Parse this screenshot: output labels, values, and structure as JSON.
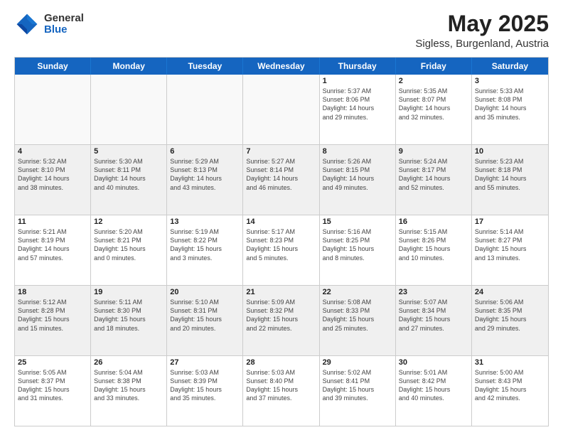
{
  "logo": {
    "general": "General",
    "blue": "Blue"
  },
  "title": "May 2025",
  "location": "Sigless, Burgenland, Austria",
  "days": [
    "Sunday",
    "Monday",
    "Tuesday",
    "Wednesday",
    "Thursday",
    "Friday",
    "Saturday"
  ],
  "rows": [
    [
      {
        "num": "",
        "info": "",
        "empty": true
      },
      {
        "num": "",
        "info": "",
        "empty": true
      },
      {
        "num": "",
        "info": "",
        "empty": true
      },
      {
        "num": "",
        "info": "",
        "empty": true
      },
      {
        "num": "1",
        "info": "Sunrise: 5:37 AM\nSunset: 8:06 PM\nDaylight: 14 hours\nand 29 minutes."
      },
      {
        "num": "2",
        "info": "Sunrise: 5:35 AM\nSunset: 8:07 PM\nDaylight: 14 hours\nand 32 minutes."
      },
      {
        "num": "3",
        "info": "Sunrise: 5:33 AM\nSunset: 8:08 PM\nDaylight: 14 hours\nand 35 minutes."
      }
    ],
    [
      {
        "num": "4",
        "info": "Sunrise: 5:32 AM\nSunset: 8:10 PM\nDaylight: 14 hours\nand 38 minutes."
      },
      {
        "num": "5",
        "info": "Sunrise: 5:30 AM\nSunset: 8:11 PM\nDaylight: 14 hours\nand 40 minutes."
      },
      {
        "num": "6",
        "info": "Sunrise: 5:29 AM\nSunset: 8:13 PM\nDaylight: 14 hours\nand 43 minutes."
      },
      {
        "num": "7",
        "info": "Sunrise: 5:27 AM\nSunset: 8:14 PM\nDaylight: 14 hours\nand 46 minutes."
      },
      {
        "num": "8",
        "info": "Sunrise: 5:26 AM\nSunset: 8:15 PM\nDaylight: 14 hours\nand 49 minutes."
      },
      {
        "num": "9",
        "info": "Sunrise: 5:24 AM\nSunset: 8:17 PM\nDaylight: 14 hours\nand 52 minutes."
      },
      {
        "num": "10",
        "info": "Sunrise: 5:23 AM\nSunset: 8:18 PM\nDaylight: 14 hours\nand 55 minutes."
      }
    ],
    [
      {
        "num": "11",
        "info": "Sunrise: 5:21 AM\nSunset: 8:19 PM\nDaylight: 14 hours\nand 57 minutes."
      },
      {
        "num": "12",
        "info": "Sunrise: 5:20 AM\nSunset: 8:21 PM\nDaylight: 15 hours\nand 0 minutes."
      },
      {
        "num": "13",
        "info": "Sunrise: 5:19 AM\nSunset: 8:22 PM\nDaylight: 15 hours\nand 3 minutes."
      },
      {
        "num": "14",
        "info": "Sunrise: 5:17 AM\nSunset: 8:23 PM\nDaylight: 15 hours\nand 5 minutes."
      },
      {
        "num": "15",
        "info": "Sunrise: 5:16 AM\nSunset: 8:25 PM\nDaylight: 15 hours\nand 8 minutes."
      },
      {
        "num": "16",
        "info": "Sunrise: 5:15 AM\nSunset: 8:26 PM\nDaylight: 15 hours\nand 10 minutes."
      },
      {
        "num": "17",
        "info": "Sunrise: 5:14 AM\nSunset: 8:27 PM\nDaylight: 15 hours\nand 13 minutes."
      }
    ],
    [
      {
        "num": "18",
        "info": "Sunrise: 5:12 AM\nSunset: 8:28 PM\nDaylight: 15 hours\nand 15 minutes."
      },
      {
        "num": "19",
        "info": "Sunrise: 5:11 AM\nSunset: 8:30 PM\nDaylight: 15 hours\nand 18 minutes."
      },
      {
        "num": "20",
        "info": "Sunrise: 5:10 AM\nSunset: 8:31 PM\nDaylight: 15 hours\nand 20 minutes."
      },
      {
        "num": "21",
        "info": "Sunrise: 5:09 AM\nSunset: 8:32 PM\nDaylight: 15 hours\nand 22 minutes."
      },
      {
        "num": "22",
        "info": "Sunrise: 5:08 AM\nSunset: 8:33 PM\nDaylight: 15 hours\nand 25 minutes."
      },
      {
        "num": "23",
        "info": "Sunrise: 5:07 AM\nSunset: 8:34 PM\nDaylight: 15 hours\nand 27 minutes."
      },
      {
        "num": "24",
        "info": "Sunrise: 5:06 AM\nSunset: 8:35 PM\nDaylight: 15 hours\nand 29 minutes."
      }
    ],
    [
      {
        "num": "25",
        "info": "Sunrise: 5:05 AM\nSunset: 8:37 PM\nDaylight: 15 hours\nand 31 minutes."
      },
      {
        "num": "26",
        "info": "Sunrise: 5:04 AM\nSunset: 8:38 PM\nDaylight: 15 hours\nand 33 minutes."
      },
      {
        "num": "27",
        "info": "Sunrise: 5:03 AM\nSunset: 8:39 PM\nDaylight: 15 hours\nand 35 minutes."
      },
      {
        "num": "28",
        "info": "Sunrise: 5:03 AM\nSunset: 8:40 PM\nDaylight: 15 hours\nand 37 minutes."
      },
      {
        "num": "29",
        "info": "Sunrise: 5:02 AM\nSunset: 8:41 PM\nDaylight: 15 hours\nand 39 minutes."
      },
      {
        "num": "30",
        "info": "Sunrise: 5:01 AM\nSunset: 8:42 PM\nDaylight: 15 hours\nand 40 minutes."
      },
      {
        "num": "31",
        "info": "Sunrise: 5:00 AM\nSunset: 8:43 PM\nDaylight: 15 hours\nand 42 minutes."
      }
    ]
  ]
}
